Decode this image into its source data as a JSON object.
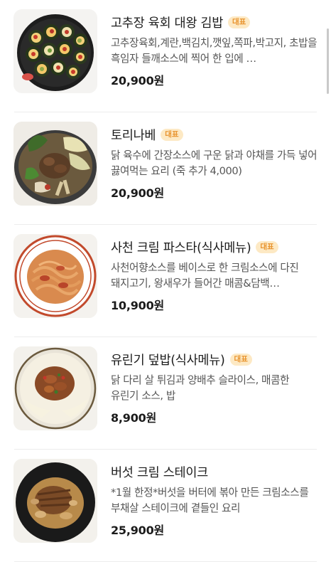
{
  "menu": {
    "items": [
      {
        "name": "고추장 육회 대왕 김밥",
        "badge": "대표",
        "description": "고추장육회,계란,백김치,깻잎,쪽파,박고지, 초밥을 흑임자 들깨소스에 찍어 한 입에 …",
        "price": "20,900원",
        "image": "kimbap-platter"
      },
      {
        "name": "토리나베",
        "badge": "대표",
        "description": "닭 육수에 간장소스에 구운 닭과 야채를 가득 넣어 끓여먹는 요리 (죽 추가 4,000)",
        "price": "20,900원",
        "image": "chicken-hotpot"
      },
      {
        "name": "사천 크림 파스타(식사메뉴)",
        "badge": "대표",
        "description": "사천어향소스를 베이스로 한 크림소스에 다진 돼지고기, 왕새우가 들어간 매콤&담백…",
        "price": "10,900원",
        "image": "cream-pasta"
      },
      {
        "name": "유린기 덮밥(식사메뉴)",
        "badge": "대표",
        "description": "닭 다리 살 튀김과 양배추 슬라이스, 매콤한 유린기 소스, 밥",
        "price": "8,900원",
        "image": "yuringi-rice-bowl"
      },
      {
        "name": "버섯 크림 스테이크",
        "badge": "",
        "description": "*1월 한정*버섯을 버터에 볶아 만든 크림소스를 부채살 스테이크에 곁들인 요리",
        "price": "25,900원",
        "image": "mushroom-cream-steak"
      }
    ]
  },
  "colors": {
    "badge_bg": "#fde9c4",
    "badge_text": "#e8932d",
    "price": "#1b1b1b",
    "description": "#555555"
  }
}
